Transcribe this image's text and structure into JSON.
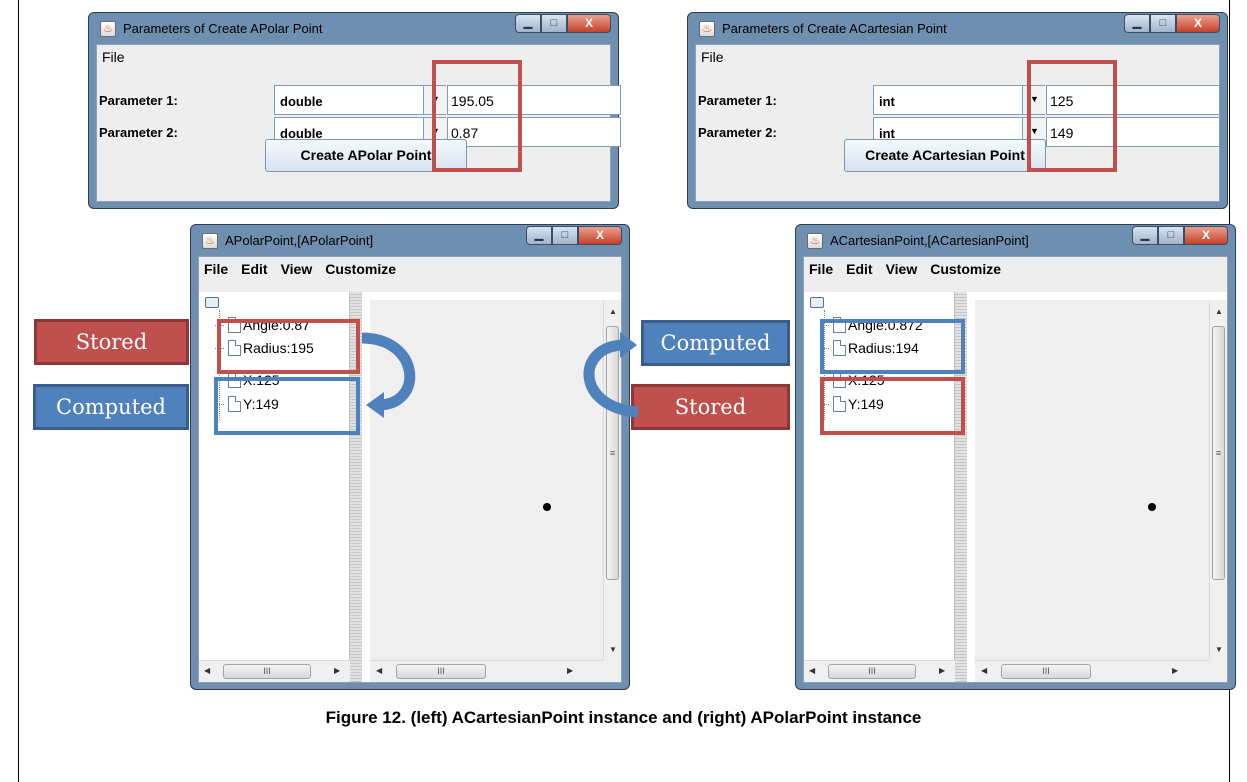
{
  "polar_params": {
    "title": "Parameters of Create  APolar Point",
    "menu": [
      "File"
    ],
    "rows": [
      {
        "label": "Parameter 1:",
        "type": "double",
        "value": "195.05"
      },
      {
        "label": "Parameter 2:",
        "type": "double",
        "value": "0.87"
      }
    ],
    "button": "Create  APolar Point"
  },
  "cartesian_params": {
    "title": "Parameters of Create  ACartesian Point",
    "menu": [
      "File"
    ],
    "rows": [
      {
        "label": "Parameter 1:",
        "type": "int",
        "value": "125"
      },
      {
        "label": "Parameter 2:",
        "type": "int",
        "value": "149"
      }
    ],
    "button": "Create  ACartesian Point"
  },
  "polar_view": {
    "title": "APolarPoint,[APolarPoint]",
    "menu": [
      "File",
      "Edit",
      "View",
      "Customize"
    ],
    "nodes": [
      "Angle:0.87",
      "Radius:195",
      "X:125",
      "Y:149"
    ]
  },
  "cartesian_view": {
    "title": "ACartesianPoint,[ACartesianPoint]",
    "menu": [
      "File",
      "Edit",
      "View",
      "Customize"
    ],
    "nodes": [
      "Angle:0.872",
      "Radius:194",
      "X:125",
      "Y:149"
    ]
  },
  "window_buttons": {
    "minimize": "▁",
    "maximize": "□",
    "close": "X"
  },
  "scroll_glyphs": {
    "up": "▲",
    "down": "▼",
    "left": "◀",
    "right": "▶",
    "grip_v": "≡",
    "grip_h": "III"
  },
  "callouts": {
    "left_stored": "Stored",
    "left_computed": "Computed",
    "right_computed": "Computed",
    "right_stored": "Stored"
  },
  "caption": "Figure 12. (left) ACartesianPoint instance and (right) APolarPoint instance",
  "colors": {
    "stored": "#c0504d",
    "computed": "#4f81bd",
    "title_bar": "#6e8fb0"
  }
}
